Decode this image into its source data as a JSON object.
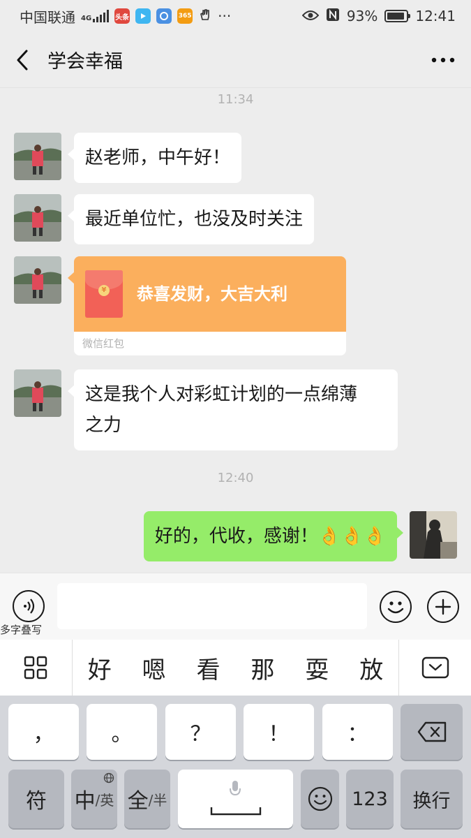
{
  "status_bar": {
    "carrier": "中国联通",
    "network": "4G",
    "app_icons": [
      {
        "name": "toutiao-icon",
        "label": "头条",
        "color": "#e0483e"
      },
      {
        "name": "video-icon",
        "label": "",
        "color": "#3fb6f1"
      },
      {
        "name": "browser-icon",
        "label": "",
        "color": "#4a90e2"
      },
      {
        "name": "sports-icon",
        "label": "365",
        "color": "#f39c12"
      }
    ],
    "battery": "93%",
    "battery_level": 0.93,
    "time": "12:41"
  },
  "nav": {
    "title": "学会幸福"
  },
  "chat": {
    "timestamp_1": "11:34",
    "messages": [
      {
        "text": "赵老师，中午好！"
      },
      {
        "text": "最近单位忙，也没及时关注"
      },
      {
        "text_line1": "这是我个人对彩虹计划的一点绵薄",
        "text_line2": "之力"
      }
    ],
    "red_packet": {
      "greeting": "恭喜发财，大吉大利",
      "label": "微信红包",
      "coin": "¥"
    },
    "timestamp_2": "12:40",
    "reply": "好的，代收，感谢！👌👌👌"
  },
  "input": {
    "voice_label": "多字叠写"
  },
  "candidates": [
    "好",
    "嗯",
    "看",
    "那",
    "耍",
    "放"
  ],
  "keyboard": {
    "row1": [
      "，",
      "。",
      "？",
      "！",
      "："
    ],
    "symbols": "符",
    "cn_en_main": "中",
    "cn_en_sub": "/英",
    "full_half_main": "全",
    "full_half_sub": "/半",
    "numbers": "123",
    "enter": "换行"
  },
  "colors": {
    "background": "#ededed",
    "my_bubble": "#95ec69",
    "red_packet": "#fbaf5d"
  }
}
